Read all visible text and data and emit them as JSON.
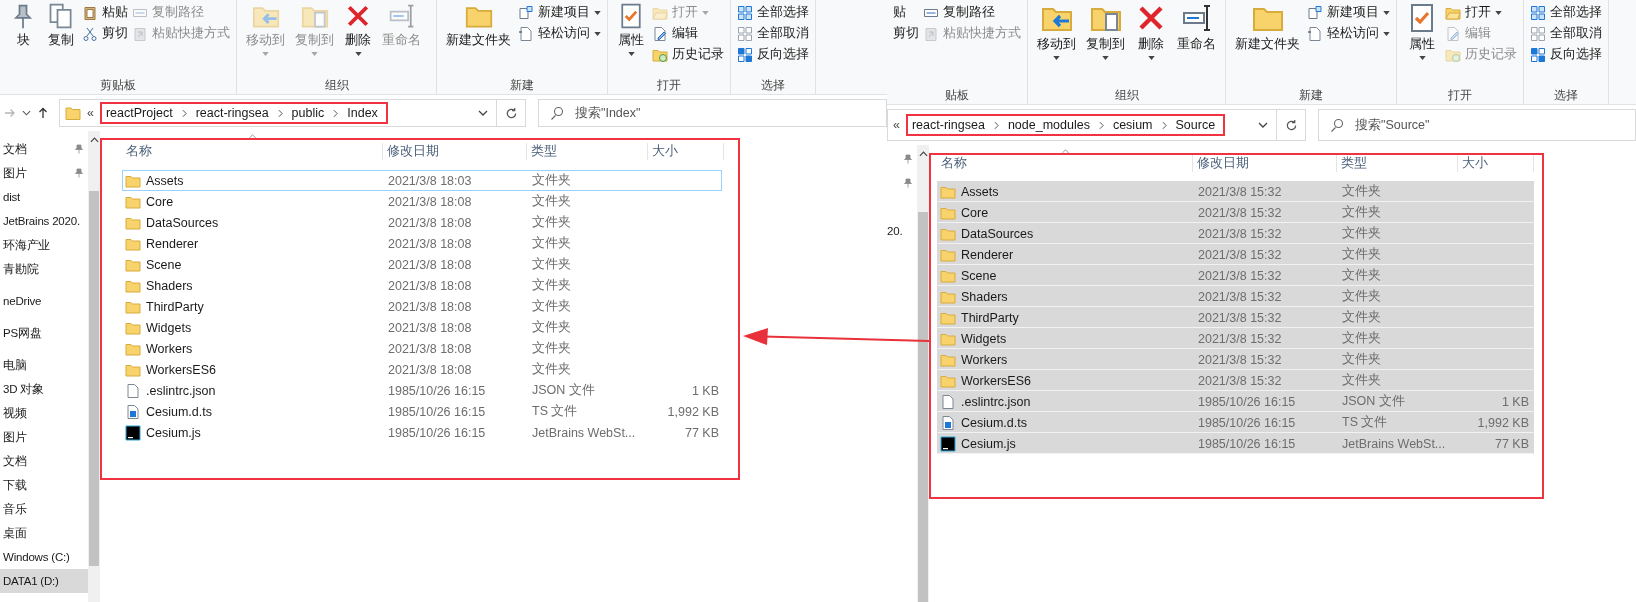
{
  "windows": [
    {
      "nav_buttons": true,
      "ribbon": {
        "groups": [
          {
            "label": "剪贴板",
            "columns": [
              {
                "kind": "large",
                "items": [
                  {
                    "label": "块",
                    "kind": "pin",
                    "disabled": false,
                    "dropdown": false
                  }
                ]
              },
              {
                "kind": "large",
                "items": [
                  {
                    "label": "复制",
                    "kind": "copy",
                    "disabled": false,
                    "dropdown": false
                  }
                ]
              },
              {
                "kind": "stack",
                "items": [
                  {
                    "label": "粘贴",
                    "kind": "paste",
                    "disabled": false,
                    "dropdown": false
                  },
                  {
                    "label": "剪切",
                    "kind": "cut",
                    "disabled": false,
                    "dropdown": false
                  }
                ]
              },
              {
                "kind": "stack",
                "items": [
                  {
                    "label": "复制路径",
                    "kind": "path",
                    "disabled": true,
                    "dropdown": false
                  },
                  {
                    "label": "粘贴快捷方式",
                    "kind": "shortcut",
                    "disabled": true,
                    "dropdown": false
                  }
                ]
              }
            ]
          },
          {
            "label": "组织",
            "columns": [
              {
                "kind": "large",
                "items": [
                  {
                    "label": "移动到",
                    "kind": "move",
                    "disabled": true,
                    "dropdown": true
                  }
                ]
              },
              {
                "kind": "large",
                "items": [
                  {
                    "label": "复制到",
                    "kind": "copyto",
                    "disabled": true,
                    "dropdown": true
                  }
                ]
              },
              {
                "kind": "large",
                "items": [
                  {
                    "label": "删除",
                    "kind": "delete",
                    "disabled": false,
                    "dropdown": true
                  }
                ]
              },
              {
                "kind": "large",
                "items": [
                  {
                    "label": "重命名",
                    "kind": "rename",
                    "disabled": true,
                    "dropdown": false
                  }
                ]
              }
            ]
          },
          {
            "label": "新建",
            "columns": [
              {
                "kind": "large",
                "items": [
                  {
                    "label": "新建文件夹",
                    "kind": "folder",
                    "disabled": false,
                    "dropdown": false
                  }
                ]
              },
              {
                "kind": "stack",
                "items": [
                  {
                    "label": "新建项目",
                    "kind": "newitem",
                    "disabled": false,
                    "dropdown": true
                  },
                  {
                    "label": "轻松访问",
                    "kind": "access",
                    "disabled": false,
                    "dropdown": true
                  }
                ]
              }
            ]
          },
          {
            "label": "打开",
            "columns": [
              {
                "kind": "large",
                "items": [
                  {
                    "label": "属性",
                    "kind": "properties",
                    "disabled": false,
                    "dropdown": true
                  }
                ]
              },
              {
                "kind": "stack",
                "items": [
                  {
                    "label": "打开",
                    "kind": "open",
                    "disabled": true,
                    "dropdown": true
                  },
                  {
                    "label": "编辑",
                    "kind": "edit",
                    "disabled": false,
                    "dropdown": false
                  },
                  {
                    "label": "历史记录",
                    "kind": "history",
                    "disabled": false,
                    "dropdown": false
                  }
                ]
              }
            ]
          },
          {
            "label": "选择",
            "columns": [
              {
                "kind": "stack",
                "items": [
                  {
                    "label": "全部选择",
                    "kind": "selectall",
                    "disabled": false,
                    "dropdown": false
                  },
                  {
                    "label": "全部取消",
                    "kind": "selectnone",
                    "disabled": false,
                    "dropdown": false
                  },
                  {
                    "label": "反向选择",
                    "kind": "invert",
                    "disabled": false,
                    "dropdown": false
                  }
                ]
              }
            ]
          }
        ]
      },
      "address": {
        "overflow": "«",
        "crumbs": [
          "reactProject",
          "react-ringsea",
          "public",
          "Index"
        ],
        "highlighted": true
      },
      "search": {
        "placeholder": "搜索\"Index\""
      },
      "sidebar": {
        "sections": [
          {
            "items": [
              {
                "label": "文档",
                "pinned": true,
                "selected": false
              },
              {
                "label": "图片",
                "pinned": true,
                "selected": false
              },
              {
                "label": "dist",
                "pinned": false,
                "selected": false
              },
              {
                "label": "JetBrains 2020.",
                "pinned": false,
                "selected": false
              },
              {
                "label": "环海产业",
                "pinned": false,
                "selected": false
              },
              {
                "label": "青勘院",
                "pinned": false,
                "selected": false
              }
            ]
          },
          {
            "items": [
              {
                "label": "neDrive",
                "pinned": false,
                "selected": false
              }
            ]
          },
          {
            "items": [
              {
                "label": "PS网盘",
                "pinned": false,
                "selected": false
              }
            ]
          },
          {
            "items": [
              {
                "label": "电脑",
                "pinned": false,
                "selected": false
              },
              {
                "label": "3D 对象",
                "pinned": false,
                "selected": false
              },
              {
                "label": "视频",
                "pinned": false,
                "selected": false
              },
              {
                "label": "图片",
                "pinned": false,
                "selected": false
              },
              {
                "label": "文档",
                "pinned": false,
                "selected": false
              },
              {
                "label": "下载",
                "pinned": false,
                "selected": false
              },
              {
                "label": "音乐",
                "pinned": false,
                "selected": false
              },
              {
                "label": "桌面",
                "pinned": false,
                "selected": false
              },
              {
                "label": "Windows (C:)",
                "pinned": false,
                "selected": false
              },
              {
                "label": "DATA1 (D:)",
                "pinned": false,
                "selected": true
              }
            ]
          }
        ]
      },
      "file_list": {
        "highlighted": true,
        "columns": [
          "名称",
          "修改日期",
          "类型",
          "大小"
        ],
        "rows": [
          {
            "name": "Assets",
            "date": "2021/3/8 18:03",
            "type": "文件夹",
            "kind": "folder",
            "selected": false,
            "focused": true
          },
          {
            "name": "Core",
            "date": "2021/3/8 18:08",
            "type": "文件夹",
            "kind": "folder",
            "selected": false,
            "focused": false
          },
          {
            "name": "DataSources",
            "date": "2021/3/8 18:08",
            "type": "文件夹",
            "kind": "folder",
            "selected": false,
            "focused": false
          },
          {
            "name": "Renderer",
            "date": "2021/3/8 18:08",
            "type": "文件夹",
            "kind": "folder",
            "selected": false,
            "focused": false
          },
          {
            "name": "Scene",
            "date": "2021/3/8 18:08",
            "type": "文件夹",
            "kind": "folder",
            "selected": false,
            "focused": false
          },
          {
            "name": "Shaders",
            "date": "2021/3/8 18:08",
            "type": "文件夹",
            "kind": "folder",
            "selected": false,
            "focused": false
          },
          {
            "name": "ThirdParty",
            "date": "2021/3/8 18:08",
            "type": "文件夹",
            "kind": "folder",
            "selected": false,
            "focused": false
          },
          {
            "name": "Widgets",
            "date": "2021/3/8 18:08",
            "type": "文件夹",
            "kind": "folder",
            "selected": false,
            "focused": false
          },
          {
            "name": "Workers",
            "date": "2021/3/8 18:08",
            "type": "文件夹",
            "kind": "folder",
            "selected": false,
            "focused": false
          },
          {
            "name": "WorkersES6",
            "date": "2021/3/8 18:08",
            "type": "文件夹",
            "kind": "folder",
            "selected": false,
            "focused": false
          },
          {
            "name": ".eslintrc.json",
            "date": "1985/10/26 16:15",
            "type": "JSON 文件",
            "size": "1 KB",
            "kind": "json",
            "selected": false,
            "focused": false
          },
          {
            "name": "Cesium.d.ts",
            "date": "1985/10/26 16:15",
            "type": "TS 文件",
            "size": "1,992 KB",
            "kind": "ts",
            "selected": false,
            "focused": false
          },
          {
            "name": "Cesium.js",
            "date": "1985/10/26 16:15",
            "type": "JetBrains WebSt...",
            "size": "77 KB",
            "kind": "ws",
            "selected": false,
            "focused": false
          }
        ]
      }
    },
    {
      "nav_buttons": false,
      "ribbon": {
        "groups": [
          {
            "label": "贴板",
            "columns": [
              {
                "kind": "stack",
                "items": [
                  {
                    "label": "贴",
                    "kind": "partial",
                    "disabled": false,
                    "dropdown": false
                  },
                  {
                    "label": "剪切",
                    "kind": "partial",
                    "disabled": false,
                    "dropdown": false
                  }
                ]
              },
              {
                "kind": "stack",
                "items": [
                  {
                    "label": "复制路径",
                    "kind": "path",
                    "disabled": false,
                    "dropdown": false
                  },
                  {
                    "label": "粘贴快捷方式",
                    "kind": "shortcut",
                    "disabled": true,
                    "dropdown": false
                  }
                ]
              }
            ]
          },
          {
            "label": "组织",
            "columns": [
              {
                "kind": "large",
                "items": [
                  {
                    "label": "移动到",
                    "kind": "move",
                    "disabled": false,
                    "dropdown": true
                  }
                ]
              },
              {
                "kind": "large",
                "items": [
                  {
                    "label": "复制到",
                    "kind": "copyto",
                    "disabled": false,
                    "dropdown": true
                  }
                ]
              },
              {
                "kind": "large",
                "items": [
                  {
                    "label": "删除",
                    "kind": "delete",
                    "disabled": false,
                    "dropdown": true
                  }
                ]
              },
              {
                "kind": "large",
                "items": [
                  {
                    "label": "重命名",
                    "kind": "rename",
                    "disabled": false,
                    "dropdown": false
                  }
                ]
              }
            ]
          },
          {
            "label": "新建",
            "columns": [
              {
                "kind": "large",
                "items": [
                  {
                    "label": "新建文件夹",
                    "kind": "folder",
                    "disabled": false,
                    "dropdown": false
                  }
                ]
              },
              {
                "kind": "stack",
                "items": [
                  {
                    "label": "新建项目",
                    "kind": "newitem",
                    "disabled": false,
                    "dropdown": true
                  },
                  {
                    "label": "轻松访问",
                    "kind": "access",
                    "disabled": false,
                    "dropdown": true
                  }
                ]
              }
            ]
          },
          {
            "label": "打开",
            "columns": [
              {
                "kind": "large",
                "items": [
                  {
                    "label": "属性",
                    "kind": "properties",
                    "disabled": false,
                    "dropdown": true
                  }
                ]
              },
              {
                "kind": "stack",
                "items": [
                  {
                    "label": "打开",
                    "kind": "open",
                    "disabled": false,
                    "dropdown": true
                  },
                  {
                    "label": "编辑",
                    "kind": "edit",
                    "disabled": true,
                    "dropdown": false
                  },
                  {
                    "label": "历史记录",
                    "kind": "history",
                    "disabled": true,
                    "dropdown": false
                  }
                ]
              }
            ]
          },
          {
            "label": "选择",
            "columns": [
              {
                "kind": "stack",
                "items": [
                  {
                    "label": "全部选择",
                    "kind": "selectall",
                    "disabled": false,
                    "dropdown": false
                  },
                  {
                    "label": "全部取消",
                    "kind": "selectnone",
                    "disabled": false,
                    "dropdown": false
                  },
                  {
                    "label": "反向选择",
                    "kind": "invert",
                    "disabled": false,
                    "dropdown": false
                  }
                ]
              }
            ]
          }
        ]
      },
      "address": {
        "overflow": "«",
        "crumbs": [
          "react-ringsea",
          "node_modules",
          "cesium",
          "Source"
        ],
        "highlighted": true
      },
      "search": {
        "placeholder": "搜索\"Source\""
      },
      "sidebar": {
        "sections": [
          {
            "items": [
              {
                "pinned": true,
                "selected": false
              },
              {
                "pinned": true,
                "selected": false
              },
              {
                "pinned": false,
                "selected": false
              },
              {
                "label": "20.",
                "pinned": false,
                "selected": false
              }
            ]
          }
        ]
      },
      "file_list": {
        "highlighted": true,
        "columns": [
          "名称",
          "修改日期",
          "类型",
          "大小"
        ],
        "rows": [
          {
            "name": "Assets",
            "date": "2021/3/8 15:32",
            "type": "文件夹",
            "kind": "folder",
            "selected": true,
            "focused": false
          },
          {
            "name": "Core",
            "date": "2021/3/8 15:32",
            "type": "文件夹",
            "kind": "folder",
            "selected": true,
            "focused": false
          },
          {
            "name": "DataSources",
            "date": "2021/3/8 15:32",
            "type": "文件夹",
            "kind": "folder",
            "selected": true,
            "focused": false
          },
          {
            "name": "Renderer",
            "date": "2021/3/8 15:32",
            "type": "文件夹",
            "kind": "folder",
            "selected": true,
            "focused": false
          },
          {
            "name": "Scene",
            "date": "2021/3/8 15:32",
            "type": "文件夹",
            "kind": "folder",
            "selected": true,
            "focused": false
          },
          {
            "name": "Shaders",
            "date": "2021/3/8 15:32",
            "type": "文件夹",
            "kind": "folder",
            "selected": true,
            "focused": false
          },
          {
            "name": "ThirdParty",
            "date": "2021/3/8 15:32",
            "type": "文件夹",
            "kind": "folder",
            "selected": true,
            "focused": false
          },
          {
            "name": "Widgets",
            "date": "2021/3/8 15:32",
            "type": "文件夹",
            "kind": "folder",
            "selected": true,
            "focused": false
          },
          {
            "name": "Workers",
            "date": "2021/3/8 15:32",
            "type": "文件夹",
            "kind": "folder",
            "selected": true,
            "focused": false
          },
          {
            "name": "WorkersES6",
            "date": "2021/3/8 15:32",
            "type": "文件夹",
            "kind": "folder",
            "selected": true,
            "focused": false
          },
          {
            "name": ".eslintrc.json",
            "date": "1985/10/26 16:15",
            "type": "JSON 文件",
            "size": "1 KB",
            "kind": "json",
            "selected": true,
            "focused": false
          },
          {
            "name": "Cesium.d.ts",
            "date": "1985/10/26 16:15",
            "type": "TS 文件",
            "size": "1,992 KB",
            "kind": "ts",
            "selected": true,
            "focused": false
          },
          {
            "name": "Cesium.js",
            "date": "1985/10/26 16:15",
            "type": "JetBrains WebSt...",
            "size": "77 KB",
            "kind": "ws",
            "selected": true,
            "focused": false
          }
        ]
      }
    }
  ]
}
